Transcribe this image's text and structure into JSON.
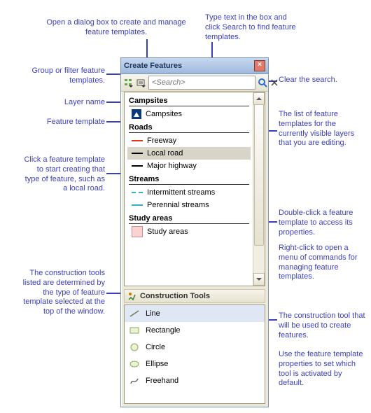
{
  "annotations": {
    "topLeft": "Open a dialog box to create and\nmanage feature templates.",
    "topRight": "Type text in the box\nand click Search to find\nfeature templates.",
    "a1": "Group or filter\nfeature templates.",
    "a2": "Layer name",
    "a3": "Feature template",
    "a4": "Click a feature\ntemplate to start\ncreating that type\nof feature, such as\na local road.",
    "a5": "The construction\ntools listed are\ndetermined by the\ntype of feature\ntemplate selected\nat the top of the\nwindow.",
    "r1": "Clear the search.",
    "r2": "The list of feature\ntemplates for the\ncurrently visible\nlayers that you are\nediting.",
    "r3": "Double-click a feature\ntemplate to access\nits properties.",
    "r4": "Right-click to open a\nmenu of commands\nfor managing feature\ntemplates.",
    "r5": "The construction tool\nthat will be used to\ncreate features.",
    "r6": "Use the feature\ntemplate properties to\nset which tool is\nactivated by default."
  },
  "panel": {
    "title": "Create Features",
    "search_placeholder": "<Search>",
    "groups": [
      {
        "name": "Campsites",
        "items": [
          {
            "label": "Campsites",
            "style": "point"
          }
        ]
      },
      {
        "name": "Roads",
        "items": [
          {
            "label": "Freeway",
            "style": "line",
            "color": "#d83a1a"
          },
          {
            "label": "Local road",
            "style": "line",
            "color": "#000000",
            "selected": true
          },
          {
            "label": "Major highway",
            "style": "line",
            "color": "#000000"
          }
        ]
      },
      {
        "name": "Streams",
        "items": [
          {
            "label": "Intermittent streams",
            "style": "dash"
          },
          {
            "label": "Perennial streams",
            "style": "line",
            "color": "#2fb4c7"
          }
        ]
      },
      {
        "name": "Study areas",
        "items": [
          {
            "label": "Study areas",
            "style": "box"
          }
        ]
      }
    ],
    "tools_title": "Construction Tools",
    "tools": [
      {
        "label": "Line",
        "icon": "line",
        "selected": true
      },
      {
        "label": "Rectangle",
        "icon": "rect"
      },
      {
        "label": "Circle",
        "icon": "circle"
      },
      {
        "label": "Ellipse",
        "icon": "ellipse"
      },
      {
        "label": "Freehand",
        "icon": "freehand"
      }
    ]
  }
}
